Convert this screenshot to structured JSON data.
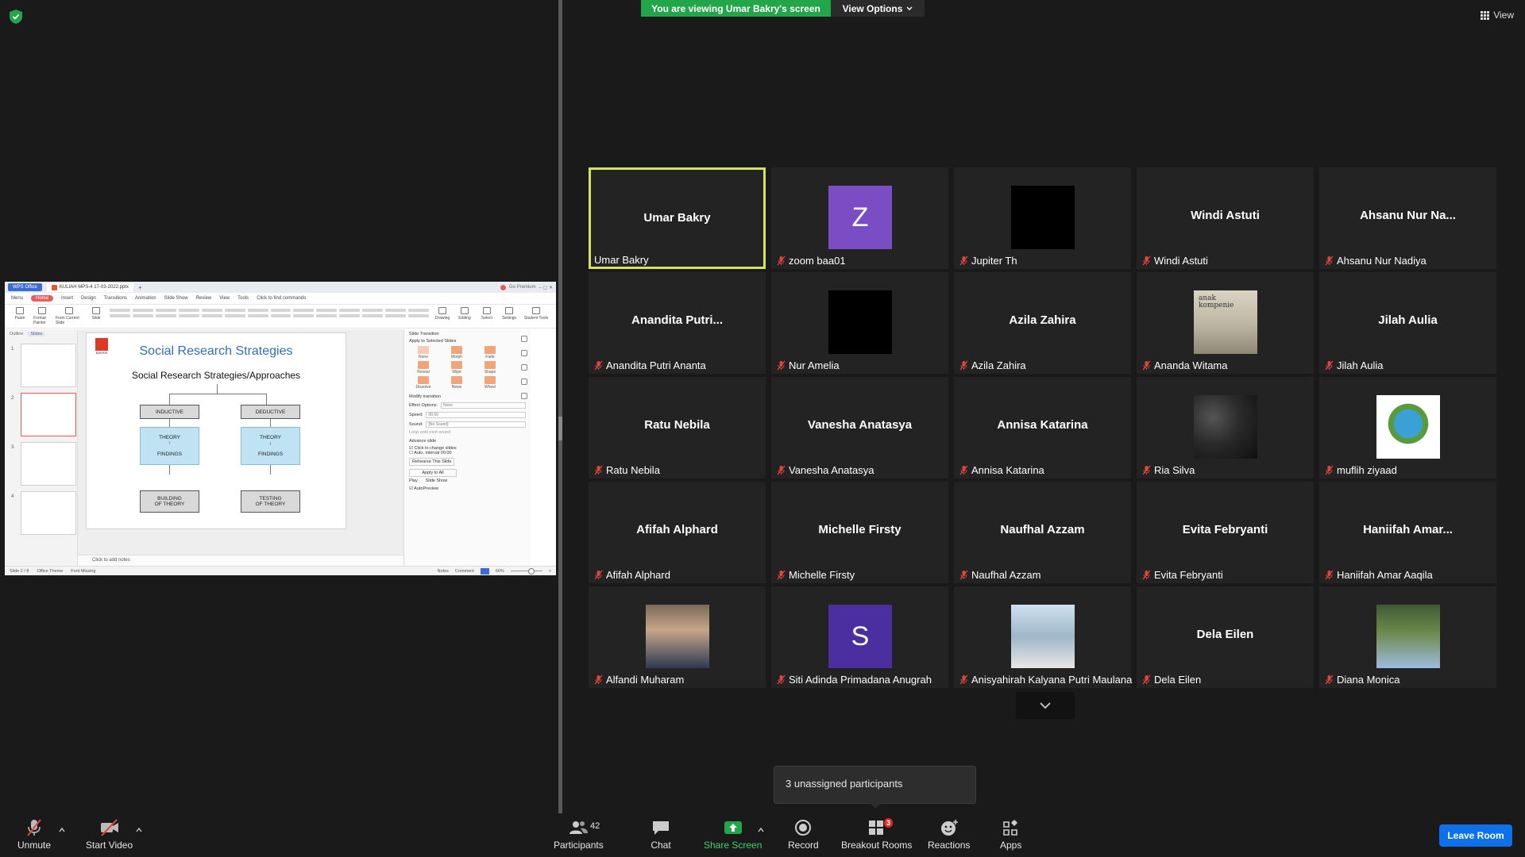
{
  "banner": {
    "viewing_text": "You are viewing Umar Bakry's screen",
    "view_options": "View Options"
  },
  "view_button": "View",
  "shared_screen": {
    "app_badge": "WPS Office",
    "doc_tab": "KULIAH MPS-4 17-03-2022.pptx",
    "premium": "Go Premium",
    "menu": [
      "Menu",
      "Home",
      "Insert",
      "Design",
      "Transitions",
      "Animation",
      "Slide Show",
      "Review",
      "View",
      "Tools",
      "Click to find commands"
    ],
    "ribbon": [
      "Paste",
      "Format Painter",
      "From Current Slide",
      "Slide",
      "Drawing",
      "Editing",
      "Select",
      "Settings",
      "Student Tools"
    ],
    "panel_tabs": [
      "Outline",
      "Slides"
    ],
    "slide": {
      "logo_text": "BAKRIE",
      "title": "Social Research Strategies",
      "subtitle": "Social Research Strategies/Approaches",
      "inductive": "INDUCTIVE",
      "deductive": "DEDUCTIVE",
      "theory": "THEORY",
      "findings": "FINDINGS",
      "building": "BUILDING",
      "testing": "TESTING",
      "of_theory": "OF THEORY"
    },
    "notes": "Click to add notes",
    "transition_panel": {
      "title": "Slide Transition",
      "apply_selected": "Apply to Selected Slides",
      "effects": [
        "None",
        "Morph",
        "Fade",
        "Reveal",
        "Wipe",
        "Shape",
        "Dissolve",
        "News",
        "Wheel"
      ],
      "modify": "Modify transition",
      "effect_options_label": "Effect Options:",
      "effect_options_value": "None",
      "speed_label": "Speed:",
      "speed_value": "00.50",
      "sound_label": "Sound:",
      "sound_value": "[No Sound]",
      "loop": "Loop until next sound",
      "advance": "Advance slide",
      "on_click": "Click to change slides",
      "auto_interval": "Auto, interval",
      "interval_value": "00:00",
      "rehearse": "Rehearse This Slide",
      "apply_all": "Apply to All",
      "play": "Play",
      "slideshow": "Slide Show",
      "autopreview": "AutoPreview"
    },
    "status": {
      "slide": "Slide 2 / 8",
      "theme": "Office Theme",
      "font": "Font Missing",
      "notes": "Notes",
      "comment": "Comment",
      "zoom": "66%"
    }
  },
  "participants": [
    {
      "name": "Umar Bakry",
      "display": "Umar Bakry",
      "muted": false,
      "active": true,
      "avatar": null
    },
    {
      "name": "zoom baa01",
      "display": "",
      "muted": true,
      "avatar": {
        "letter": "Z",
        "color": "#7b4dc4"
      }
    },
    {
      "name": "Jupiter Th",
      "display": "",
      "muted": true,
      "avatar": {
        "type": "black"
      }
    },
    {
      "name": "Windi Astuti",
      "display": "Windi Astuti",
      "muted": true
    },
    {
      "name": "Ahsanu Nur Nadiya",
      "display": "Ahsanu Nur Na...",
      "muted": true
    },
    {
      "name": "Anandita Putri Ananta",
      "display": "Anandita  Putri...",
      "muted": true
    },
    {
      "name": "Nur Amelia",
      "display": "",
      "muted": true,
      "avatar": {
        "type": "black"
      }
    },
    {
      "name": "Azila Zahira",
      "display": "Azila Zahira",
      "muted": true
    },
    {
      "name": "Ananda Witama",
      "display": "",
      "muted": true,
      "avatar": {
        "type": "photo-vintage",
        "caption": "anak kompenie"
      }
    },
    {
      "name": "Jilah Aulia",
      "display": "Jilah Aulia",
      "muted": true
    },
    {
      "name": "Ratu Nebila",
      "display": "Ratu Nebila",
      "muted": true
    },
    {
      "name": "Vanesha Anatasya",
      "display": "Vanesha Anatasya",
      "muted": true
    },
    {
      "name": "Annisa Katarina",
      "display": "Annisa Katarina",
      "muted": true
    },
    {
      "name": "Ria Silva",
      "display": "",
      "muted": true,
      "avatar": {
        "type": "photo-night"
      }
    },
    {
      "name": "muflih ziyaad",
      "display": "",
      "muted": true,
      "avatar": {
        "type": "photo-earth"
      }
    },
    {
      "name": "Afifah Alphard",
      "display": "Afifah Alphard",
      "muted": true
    },
    {
      "name": "Michelle Firsty",
      "display": "Michelle Firsty",
      "muted": true
    },
    {
      "name": "Naufhal Azzam",
      "display": "Naufhal Azzam",
      "muted": true
    },
    {
      "name": "Evita Febryanti",
      "display": "Evita Febryanti",
      "muted": true
    },
    {
      "name": "Haniifah Amar Aaqila",
      "display": "Haniifah  Amar...",
      "muted": true
    },
    {
      "name": "Alfandi Muharam",
      "display": "",
      "muted": true,
      "avatar": {
        "type": "photo-person"
      }
    },
    {
      "name": "Siti Adinda Primadana Anugrah",
      "display": "",
      "muted": true,
      "avatar": {
        "letter": "S",
        "color": "#4b2fa0"
      }
    },
    {
      "name": "Anisyahirah Kalyana Putri Maulana",
      "display": "",
      "muted": true,
      "avatar": {
        "type": "photo-building"
      }
    },
    {
      "name": "Dela Eilen",
      "display": "Dela Eilen",
      "muted": true
    },
    {
      "name": "Diana Monica",
      "display": "",
      "muted": true,
      "avatar": {
        "type": "photo-garden"
      }
    }
  ],
  "toast": "3 unassigned participants",
  "toolbar": {
    "unmute": "Unmute",
    "start_video": "Start Video",
    "participants": "Participants",
    "participants_count": "42",
    "chat": "Chat",
    "share_screen": "Share Screen",
    "record": "Record",
    "breakout_rooms": "Breakout Rooms",
    "breakout_badge": "3",
    "reactions": "Reactions",
    "apps": "Apps",
    "leave": "Leave Room"
  },
  "colors": {
    "active_border": "#d6e35a",
    "share_green": "#23a54a",
    "leave_blue": "#0e71eb",
    "mute_red": "#e0443e"
  }
}
